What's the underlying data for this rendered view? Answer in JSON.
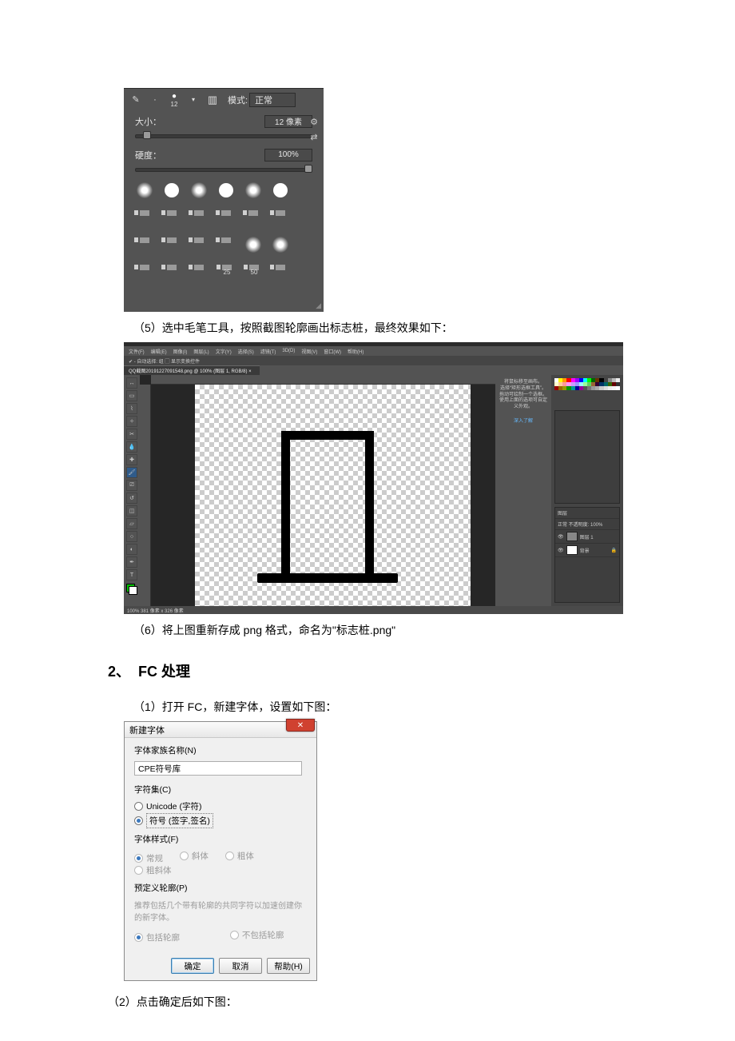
{
  "fig1": {
    "mode_label": "模式:",
    "mode_value": "正常",
    "brush_num": "12",
    "size_label": "大小：",
    "size_value": "12 像素",
    "hard_label": "硬度：",
    "hard_value": "100%",
    "side_gear": "⚙",
    "side_swap": "⇄",
    "lbl25": "25",
    "lbl50": "50"
  },
  "caption5": "（5）选中毛笔工具，按照截图轮廓画出标志桩，最终效果如下：",
  "fig2": {
    "menu": [
      "文件(F)",
      "编辑(E)",
      "图像(I)",
      "图层(L)",
      "文字(Y)",
      "选择(S)",
      "滤镜(T)",
      "3D(D)",
      "视图(V)",
      "窗口(W)",
      "帮助(H)"
    ],
    "opt": "✔ - 自动选择: 组 ▢ 显示变换控件",
    "tab": "QQ截图20191227091548.png @ 100% (图层 1, RGB/8) ×",
    "mini1": "将鼠标移至画布。\n选择“矩形选框工具”。\n拖动可绘制一个选框。使用上面的选项可自定义外观。",
    "mini2": "深入了解",
    "status": "100%    381 像素 x 326 像素",
    "layers_tab": "图层",
    "layers_ctrl": "正常      不透明度: 100%",
    "ly1": "图层 1",
    "ly0": "背景"
  },
  "caption6": "（6）将上图重新存成 png 格式，命名为\"标志桩.png\"",
  "heading2_num": "2、",
  "heading2_text": "FC 处理",
  "caption2_1": "（1）打开 FC，新建字体，设置如下图：",
  "fc": {
    "title": "新建字体",
    "family_label": "字体家族名称(N)",
    "family_value": "CPE符号库",
    "charset_label": "字符集(C)",
    "charset_unicode": "Unicode (字符)",
    "charset_symbol": "符号 (签字,签名)",
    "style_label": "字体样式(F)",
    "style_regular": "常规",
    "style_italic": "斜体",
    "style_bold": "粗体",
    "style_bi": "粗斜体",
    "outline_label": "预定义轮廓(P)",
    "outline_note": "推荐包括几个带有轮廓的共同字符以加速创建你的新字体。",
    "outline_yes": "包括轮廓",
    "outline_no": "不包括轮廓",
    "btn_ok": "确定",
    "btn_cancel": "取消",
    "btn_help": "帮助(H)"
  },
  "caption2_2": "（2）点击确定后如下图："
}
